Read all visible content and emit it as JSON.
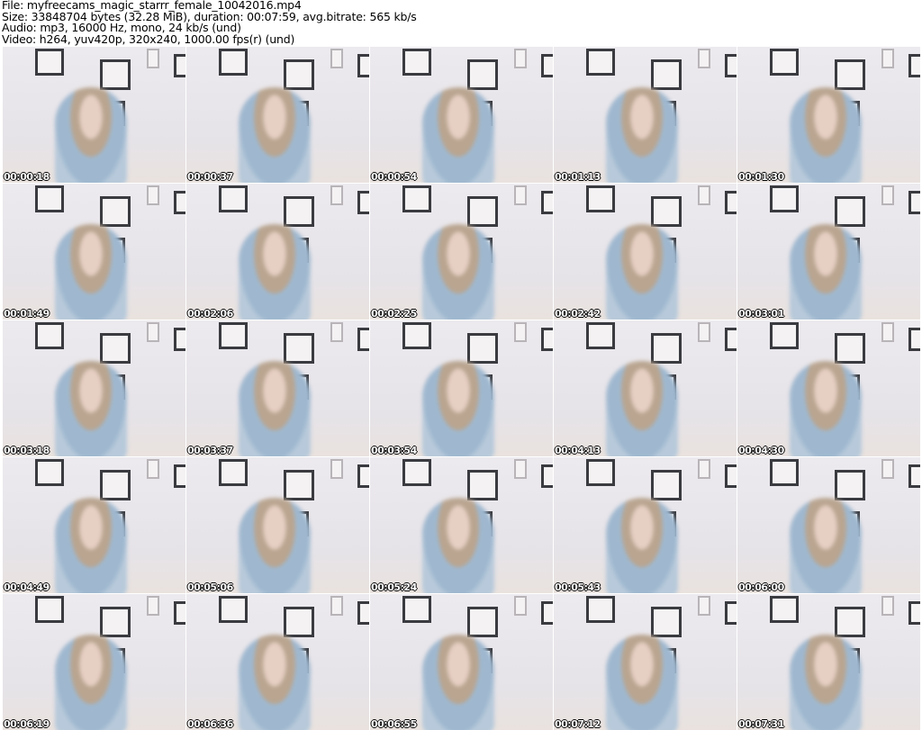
{
  "header": {
    "file_line": "File: myfreecams_magic_starrr_female_10042016.mp4",
    "size_line": "Size: 33848704 bytes (32.28 MiB), duration: 00:07:59, avg.bitrate: 565 kb/s",
    "audio_line": "Audio: mp3, 16000 Hz, mono, 24 kb/s (und)",
    "video_line": "Video: h264, yuv420p, 320x240, 1000.00 fps(r) (und)"
  },
  "thumbnails": [
    "00:00:18",
    "00:00:37",
    "00:00:54",
    "00:01:13",
    "00:01:30",
    "00:01:49",
    "00:02:06",
    "00:02:25",
    "00:02:42",
    "00:03:01",
    "00:03:18",
    "00:03:37",
    "00:03:54",
    "00:04:13",
    "00:04:30",
    "00:04:49",
    "00:05:06",
    "00:05:24",
    "00:05:43",
    "00:06:00",
    "00:06:19",
    "00:06:36",
    "00:06:55",
    "00:07:12",
    "00:07:31"
  ]
}
